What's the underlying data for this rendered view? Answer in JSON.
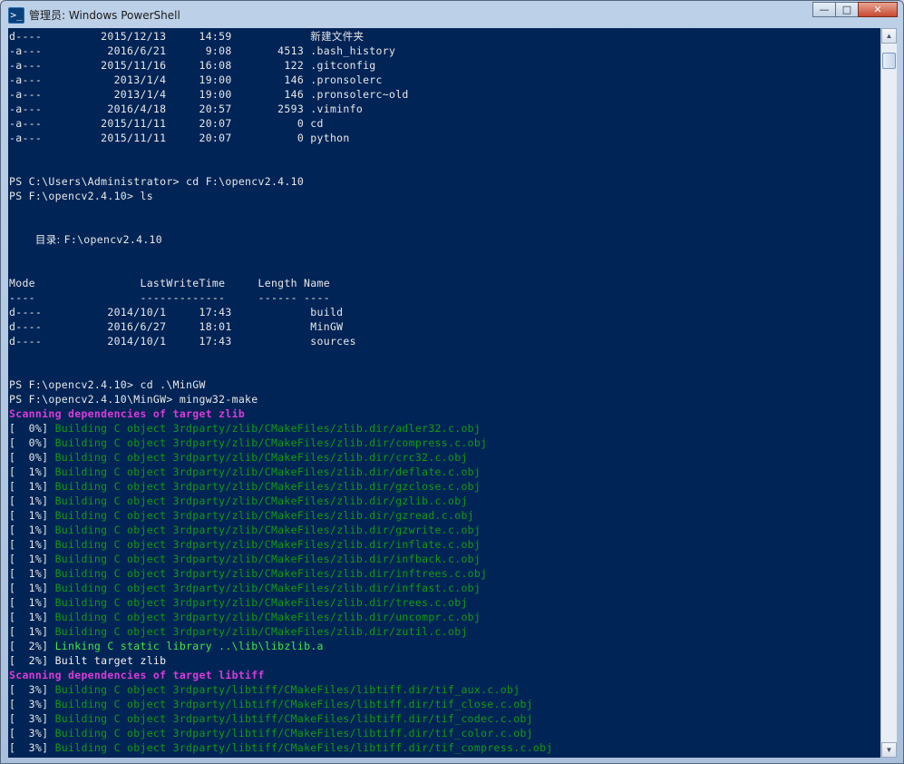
{
  "window": {
    "title": "管理员: Windows PowerShell",
    "icon_glyph": ">_",
    "controls": {
      "minimize": "—",
      "maximize": "□",
      "close": "✕"
    }
  },
  "scrollbar": {
    "up_arrow": "▲",
    "down_arrow": "▼"
  },
  "console": {
    "lines": [
      [
        {
          "t": "d----         2015/12/13     14:59            ",
          "c": "default"
        },
        {
          "t": "新建文件夹",
          "c": "default",
          "cjk": true
        }
      ],
      [
        {
          "t": "-a---          2016/6/21      9:08       4513 .bash_history",
          "c": "default"
        }
      ],
      [
        {
          "t": "-a---         2015/11/16     16:08        122 .gitconfig",
          "c": "default"
        }
      ],
      [
        {
          "t": "-a---           2013/1/4     19:00        146 .pronsolerc",
          "c": "default"
        }
      ],
      [
        {
          "t": "-a---           2013/1/4     19:00        146 .pronsolerc~old",
          "c": "default"
        }
      ],
      [
        {
          "t": "-a---          2016/4/18     20:57       2593 .viminfo",
          "c": "default"
        }
      ],
      [
        {
          "t": "-a---         2015/11/11     20:07          0 cd",
          "c": "default"
        }
      ],
      [
        {
          "t": "-a---         2015/11/11     20:07          0 python",
          "c": "default"
        }
      ],
      [
        {
          "t": "",
          "c": "default"
        }
      ],
      [
        {
          "t": "",
          "c": "default"
        }
      ],
      [
        {
          "t": "PS C:\\Users\\Administrator> cd F:\\opencv2.4.10",
          "c": "default"
        }
      ],
      [
        {
          "t": "PS F:\\opencv2.4.10> ls",
          "c": "default"
        }
      ],
      [
        {
          "t": "",
          "c": "default"
        }
      ],
      [
        {
          "t": "",
          "c": "default"
        }
      ],
      [
        {
          "t": "    ",
          "c": "default"
        },
        {
          "t": "目录: ",
          "c": "default",
          "cjk": true
        },
        {
          "t": "F:\\opencv2.4.10",
          "c": "default"
        }
      ],
      [
        {
          "t": "",
          "c": "default"
        }
      ],
      [
        {
          "t": "",
          "c": "default"
        }
      ],
      [
        {
          "t": "Mode                LastWriteTime     Length Name",
          "c": "default"
        }
      ],
      [
        {
          "t": "----                -------------     ------ ----",
          "c": "default"
        }
      ],
      [
        {
          "t": "d----          2014/10/1     17:43            build",
          "c": "default"
        }
      ],
      [
        {
          "t": "d----          2016/6/27     18:01            MinGW",
          "c": "default"
        }
      ],
      [
        {
          "t": "d----          2014/10/1     17:43            sources",
          "c": "default"
        }
      ],
      [
        {
          "t": "",
          "c": "default"
        }
      ],
      [
        {
          "t": "",
          "c": "default"
        }
      ],
      [
        {
          "t": "PS F:\\opencv2.4.10> cd .\\MinGW",
          "c": "default"
        }
      ],
      [
        {
          "t": "PS F:\\opencv2.4.10\\MinGW> mingw32-make",
          "c": "default"
        }
      ],
      [
        {
          "t": "Scanning dependencies of target zlib",
          "c": "magenta"
        }
      ],
      [
        {
          "t": "[  0%] ",
          "c": "default"
        },
        {
          "t": "Building C object 3rdparty/zlib/CMakeFiles/zlib.dir/adler32.c.obj",
          "c": "green"
        }
      ],
      [
        {
          "t": "[  0%] ",
          "c": "default"
        },
        {
          "t": "Building C object 3rdparty/zlib/CMakeFiles/zlib.dir/compress.c.obj",
          "c": "green"
        }
      ],
      [
        {
          "t": "[  0%] ",
          "c": "default"
        },
        {
          "t": "Building C object 3rdparty/zlib/CMakeFiles/zlib.dir/crc32.c.obj",
          "c": "green"
        }
      ],
      [
        {
          "t": "[  1%] ",
          "c": "default"
        },
        {
          "t": "Building C object 3rdparty/zlib/CMakeFiles/zlib.dir/deflate.c.obj",
          "c": "green"
        }
      ],
      [
        {
          "t": "[  1%] ",
          "c": "default"
        },
        {
          "t": "Building C object 3rdparty/zlib/CMakeFiles/zlib.dir/gzclose.c.obj",
          "c": "green"
        }
      ],
      [
        {
          "t": "[  1%] ",
          "c": "default"
        },
        {
          "t": "Building C object 3rdparty/zlib/CMakeFiles/zlib.dir/gzlib.c.obj",
          "c": "green"
        }
      ],
      [
        {
          "t": "[  1%] ",
          "c": "default"
        },
        {
          "t": "Building C object 3rdparty/zlib/CMakeFiles/zlib.dir/gzread.c.obj",
          "c": "green"
        }
      ],
      [
        {
          "t": "[  1%] ",
          "c": "default"
        },
        {
          "t": "Building C object 3rdparty/zlib/CMakeFiles/zlib.dir/gzwrite.c.obj",
          "c": "green"
        }
      ],
      [
        {
          "t": "[  1%] ",
          "c": "default"
        },
        {
          "t": "Building C object 3rdparty/zlib/CMakeFiles/zlib.dir/inflate.c.obj",
          "c": "green"
        }
      ],
      [
        {
          "t": "[  1%] ",
          "c": "default"
        },
        {
          "t": "Building C object 3rdparty/zlib/CMakeFiles/zlib.dir/infback.c.obj",
          "c": "green"
        }
      ],
      [
        {
          "t": "[  1%] ",
          "c": "default"
        },
        {
          "t": "Building C object 3rdparty/zlib/CMakeFiles/zlib.dir/inftrees.c.obj",
          "c": "green"
        }
      ],
      [
        {
          "t": "[  1%] ",
          "c": "default"
        },
        {
          "t": "Building C object 3rdparty/zlib/CMakeFiles/zlib.dir/inffast.c.obj",
          "c": "green"
        }
      ],
      [
        {
          "t": "[  1%] ",
          "c": "default"
        },
        {
          "t": "Building C object 3rdparty/zlib/CMakeFiles/zlib.dir/trees.c.obj",
          "c": "green"
        }
      ],
      [
        {
          "t": "[  1%] ",
          "c": "default"
        },
        {
          "t": "Building C object 3rdparty/zlib/CMakeFiles/zlib.dir/uncompr.c.obj",
          "c": "green"
        }
      ],
      [
        {
          "t": "[  1%] ",
          "c": "default"
        },
        {
          "t": "Building C object 3rdparty/zlib/CMakeFiles/zlib.dir/zutil.c.obj",
          "c": "green"
        }
      ],
      [
        {
          "t": "[  2%] ",
          "c": "default"
        },
        {
          "t": "Linking C static library ..\\lib\\libzlib.a",
          "c": "bright"
        }
      ],
      [
        {
          "t": "[  2%] Built target zlib",
          "c": "white"
        }
      ],
      [
        {
          "t": "Scanning dependencies of target libtiff",
          "c": "magenta"
        }
      ],
      [
        {
          "t": "[  3%] ",
          "c": "default"
        },
        {
          "t": "Building C object 3rdparty/libtiff/CMakeFiles/libtiff.dir/tif_aux.c.obj",
          "c": "green"
        }
      ],
      [
        {
          "t": "[  3%] ",
          "c": "default"
        },
        {
          "t": "Building C object 3rdparty/libtiff/CMakeFiles/libtiff.dir/tif_close.c.obj",
          "c": "green"
        }
      ],
      [
        {
          "t": "[  3%] ",
          "c": "default"
        },
        {
          "t": "Building C object 3rdparty/libtiff/CMakeFiles/libtiff.dir/tif_codec.c.obj",
          "c": "green"
        }
      ],
      [
        {
          "t": "[  3%] ",
          "c": "default"
        },
        {
          "t": "Building C object 3rdparty/libtiff/CMakeFiles/libtiff.dir/tif_color.c.obj",
          "c": "green"
        }
      ],
      [
        {
          "t": "[  3%] ",
          "c": "default"
        },
        {
          "t": "Building C object 3rdparty/libtiff/CMakeFiles/libtiff.dir/tif_compress.c.obj",
          "c": "green"
        }
      ]
    ]
  },
  "colors": {
    "console_bg": "#012456",
    "text": "#e8e8e8",
    "green": "#119c11",
    "bright_green": "#45e845",
    "magenta": "#d93cd9"
  }
}
